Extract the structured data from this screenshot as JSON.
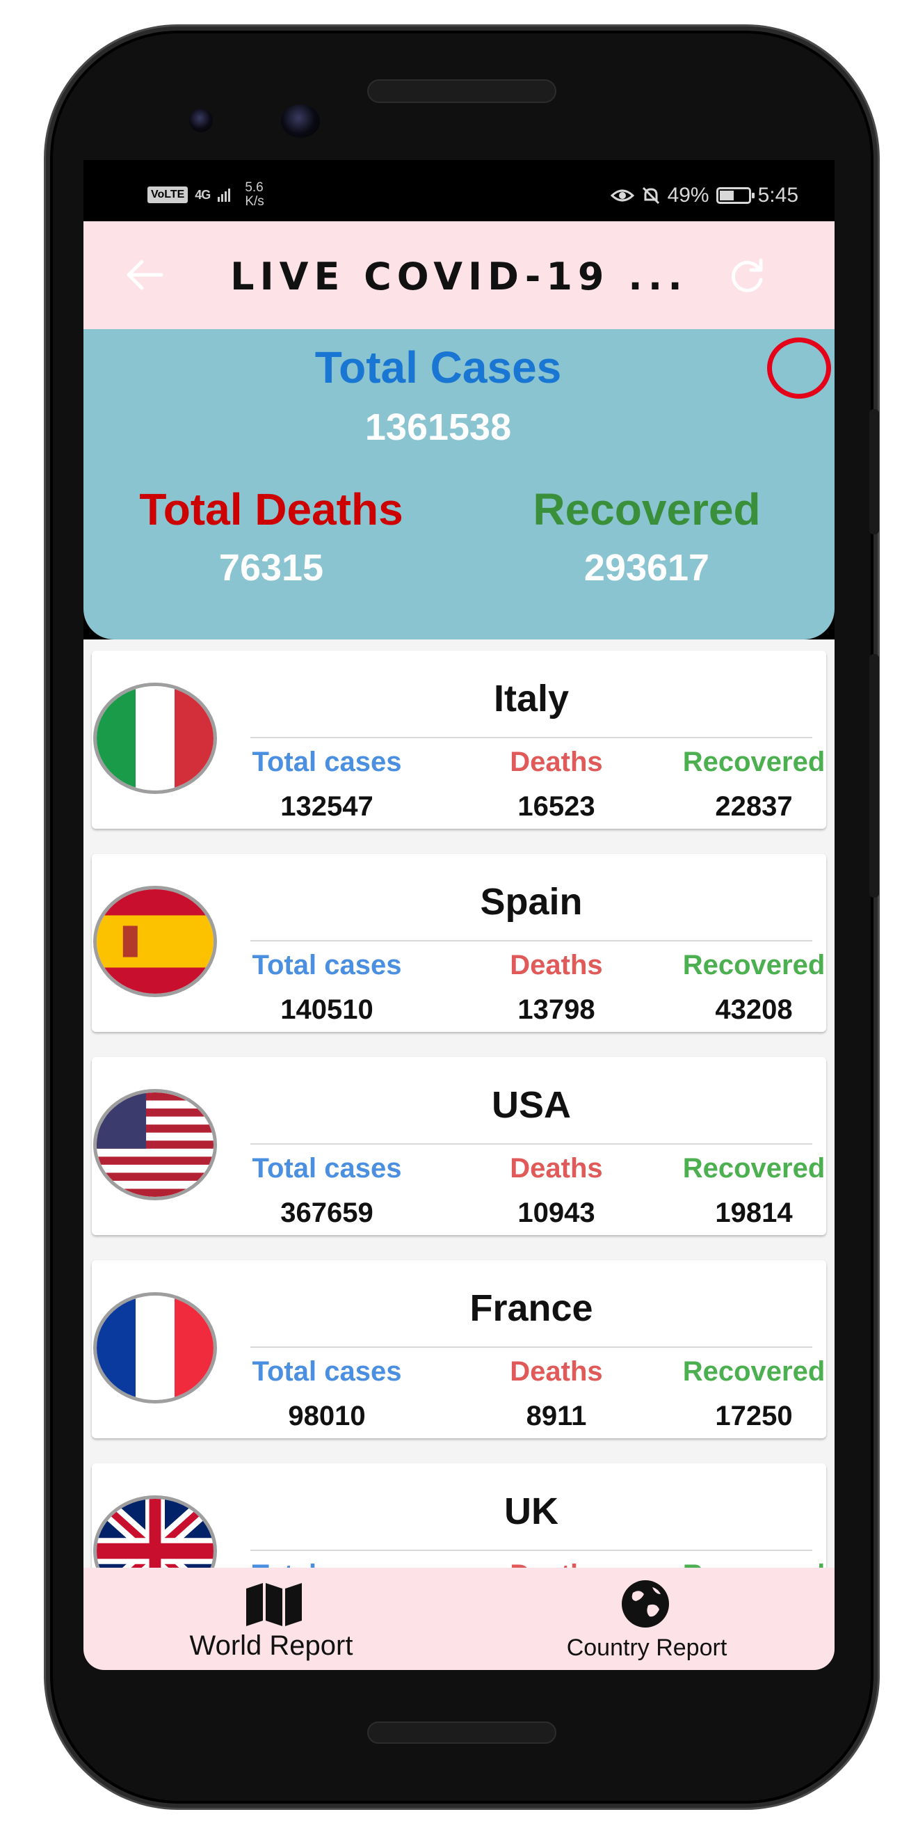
{
  "status_bar": {
    "volte": "VoLTE",
    "network": "4G",
    "net_speed_value": "5.6",
    "net_speed_unit": "K/s",
    "battery": "49%",
    "time": "5:45"
  },
  "app_bar": {
    "title": "LIVE COVID-19 ..."
  },
  "summary": {
    "total_cases_label": "Total Cases",
    "total_cases": "1361538",
    "total_deaths_label": "Total Deaths",
    "total_deaths": "76315",
    "recovered_label": "Recovered",
    "recovered": "293617"
  },
  "columns": {
    "cases": "Total cases",
    "deaths": "Deaths",
    "recovered": "Recovered"
  },
  "colors": {
    "app_bar_bg": "#fde2e8",
    "summary_bg": "#8ac4d0",
    "total_cases_blue": "#1976d2",
    "deaths_red": "#cc0000",
    "recovered_green": "#3a8f3a",
    "col_cases": "#4a8fe0",
    "col_deaths": "#e05a5a",
    "col_recovered": "#4caf50"
  },
  "countries": [
    {
      "name": "Italy",
      "flag": "flag-italy",
      "cases": "132547",
      "deaths": "16523",
      "recovered": "22837"
    },
    {
      "name": "Spain",
      "flag": "flag-spain",
      "cases": "140510",
      "deaths": "13798",
      "recovered": "43208"
    },
    {
      "name": "USA",
      "flag": "flag-usa",
      "cases": "367659",
      "deaths": "10943",
      "recovered": "19814"
    },
    {
      "name": "France",
      "flag": "flag-france",
      "cases": "98010",
      "deaths": "8911",
      "recovered": "17250"
    },
    {
      "name": "UK",
      "flag": "flag-uk",
      "cases": "",
      "deaths": "",
      "recovered": ""
    }
  ],
  "bottom_nav": {
    "world_label": "World Report",
    "world_icon": "map-icon",
    "country_label": "Country Report",
    "country_icon": "globe-icon"
  }
}
